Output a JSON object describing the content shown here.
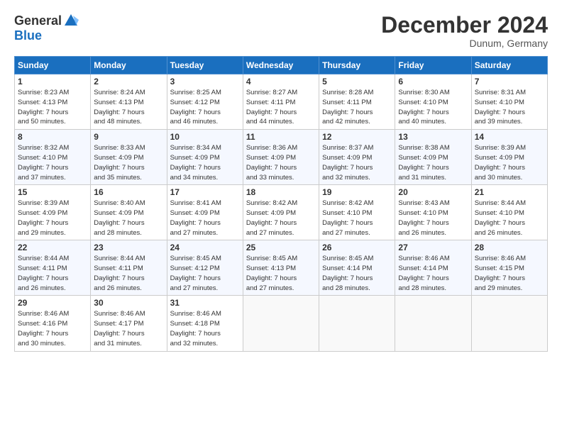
{
  "header": {
    "logo_general": "General",
    "logo_blue": "Blue",
    "month_title": "December 2024",
    "location": "Dunum, Germany"
  },
  "weekdays": [
    "Sunday",
    "Monday",
    "Tuesday",
    "Wednesday",
    "Thursday",
    "Friday",
    "Saturday"
  ],
  "weeks": [
    [
      {
        "day": "1",
        "sunrise": "8:23 AM",
        "sunset": "4:13 PM",
        "daylight": "7 hours and 50 minutes."
      },
      {
        "day": "2",
        "sunrise": "8:24 AM",
        "sunset": "4:13 PM",
        "daylight": "7 hours and 48 minutes."
      },
      {
        "day": "3",
        "sunrise": "8:25 AM",
        "sunset": "4:12 PM",
        "daylight": "7 hours and 46 minutes."
      },
      {
        "day": "4",
        "sunrise": "8:27 AM",
        "sunset": "4:11 PM",
        "daylight": "7 hours and 44 minutes."
      },
      {
        "day": "5",
        "sunrise": "8:28 AM",
        "sunset": "4:11 PM",
        "daylight": "7 hours and 42 minutes."
      },
      {
        "day": "6",
        "sunrise": "8:30 AM",
        "sunset": "4:10 PM",
        "daylight": "7 hours and 40 minutes."
      },
      {
        "day": "7",
        "sunrise": "8:31 AM",
        "sunset": "4:10 PM",
        "daylight": "7 hours and 39 minutes."
      }
    ],
    [
      {
        "day": "8",
        "sunrise": "8:32 AM",
        "sunset": "4:10 PM",
        "daylight": "7 hours and 37 minutes."
      },
      {
        "day": "9",
        "sunrise": "8:33 AM",
        "sunset": "4:09 PM",
        "daylight": "7 hours and 35 minutes."
      },
      {
        "day": "10",
        "sunrise": "8:34 AM",
        "sunset": "4:09 PM",
        "daylight": "7 hours and 34 minutes."
      },
      {
        "day": "11",
        "sunrise": "8:36 AM",
        "sunset": "4:09 PM",
        "daylight": "7 hours and 33 minutes."
      },
      {
        "day": "12",
        "sunrise": "8:37 AM",
        "sunset": "4:09 PM",
        "daylight": "7 hours and 32 minutes."
      },
      {
        "day": "13",
        "sunrise": "8:38 AM",
        "sunset": "4:09 PM",
        "daylight": "7 hours and 31 minutes."
      },
      {
        "day": "14",
        "sunrise": "8:39 AM",
        "sunset": "4:09 PM",
        "daylight": "7 hours and 30 minutes."
      }
    ],
    [
      {
        "day": "15",
        "sunrise": "8:39 AM",
        "sunset": "4:09 PM",
        "daylight": "7 hours and 29 minutes."
      },
      {
        "day": "16",
        "sunrise": "8:40 AM",
        "sunset": "4:09 PM",
        "daylight": "7 hours and 28 minutes."
      },
      {
        "day": "17",
        "sunrise": "8:41 AM",
        "sunset": "4:09 PM",
        "daylight": "7 hours and 27 minutes."
      },
      {
        "day": "18",
        "sunrise": "8:42 AM",
        "sunset": "4:09 PM",
        "daylight": "7 hours and 27 minutes."
      },
      {
        "day": "19",
        "sunrise": "8:42 AM",
        "sunset": "4:10 PM",
        "daylight": "7 hours and 27 minutes."
      },
      {
        "day": "20",
        "sunrise": "8:43 AM",
        "sunset": "4:10 PM",
        "daylight": "7 hours and 26 minutes."
      },
      {
        "day": "21",
        "sunrise": "8:44 AM",
        "sunset": "4:10 PM",
        "daylight": "7 hours and 26 minutes."
      }
    ],
    [
      {
        "day": "22",
        "sunrise": "8:44 AM",
        "sunset": "4:11 PM",
        "daylight": "7 hours and 26 minutes."
      },
      {
        "day": "23",
        "sunrise": "8:44 AM",
        "sunset": "4:11 PM",
        "daylight": "7 hours and 26 minutes."
      },
      {
        "day": "24",
        "sunrise": "8:45 AM",
        "sunset": "4:12 PM",
        "daylight": "7 hours and 27 minutes."
      },
      {
        "day": "25",
        "sunrise": "8:45 AM",
        "sunset": "4:13 PM",
        "daylight": "7 hours and 27 minutes."
      },
      {
        "day": "26",
        "sunrise": "8:45 AM",
        "sunset": "4:14 PM",
        "daylight": "7 hours and 28 minutes."
      },
      {
        "day": "27",
        "sunrise": "8:46 AM",
        "sunset": "4:14 PM",
        "daylight": "7 hours and 28 minutes."
      },
      {
        "day": "28",
        "sunrise": "8:46 AM",
        "sunset": "4:15 PM",
        "daylight": "7 hours and 29 minutes."
      }
    ],
    [
      {
        "day": "29",
        "sunrise": "8:46 AM",
        "sunset": "4:16 PM",
        "daylight": "7 hours and 30 minutes."
      },
      {
        "day": "30",
        "sunrise": "8:46 AM",
        "sunset": "4:17 PM",
        "daylight": "7 hours and 31 minutes."
      },
      {
        "day": "31",
        "sunrise": "8:46 AM",
        "sunset": "4:18 PM",
        "daylight": "7 hours and 32 minutes."
      },
      null,
      null,
      null,
      null
    ]
  ],
  "labels": {
    "sunrise": "Sunrise:",
    "sunset": "Sunset:",
    "daylight": "Daylight:"
  }
}
